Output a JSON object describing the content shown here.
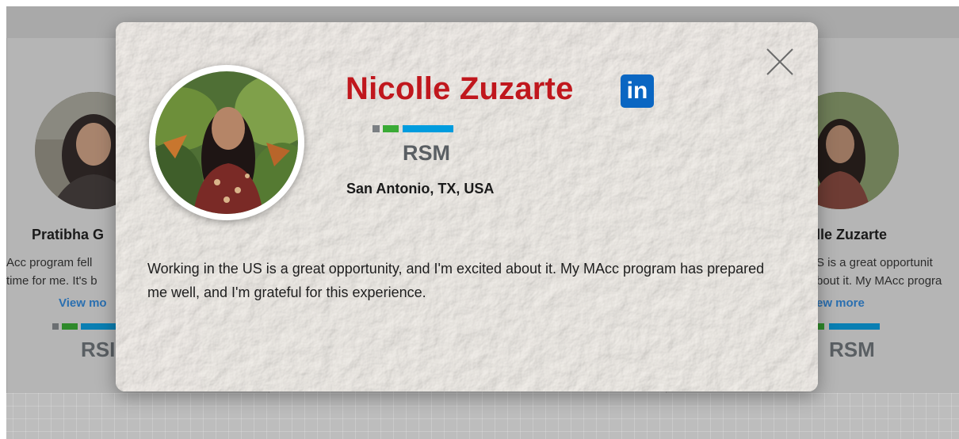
{
  "background": {
    "left_card": {
      "name": "Pratibha G",
      "text_lines": [
        "Acc program fell",
        "time for me. It's b"
      ],
      "link": "View mo",
      "logo_text": "RSI"
    },
    "right_card": {
      "name": "lle Zuzarte",
      "text_lines": [
        "S is a great opportunit",
        "bout it. My MAcc progra"
      ],
      "link": "ew more",
      "logo_text": "RSM"
    }
  },
  "modal": {
    "name": "Nicolle Zuzarte",
    "linkedin_label": "in",
    "company_logo_text": "RSM",
    "location": "San Antonio, TX, USA",
    "quote": "Working in the US is a great opportunity, and I'm excited about it. My MAcc program has prepared me well, and I'm grateful for this experience.",
    "close_icon": "close-icon"
  },
  "colors": {
    "name_red": "#c0171d",
    "linkedin_blue": "#0a66c2",
    "link_blue": "#2a6fb0",
    "rsm_gray": "#7b7f83",
    "rsm_green": "#3aaa35",
    "rsm_blue": "#009cde"
  }
}
